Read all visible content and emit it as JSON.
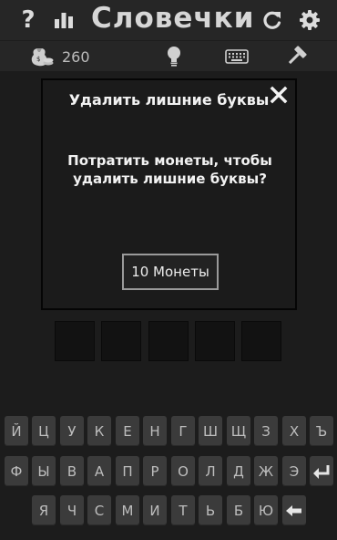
{
  "header": {
    "title": "Словечки",
    "help_label": "?"
  },
  "toolbar": {
    "coins": "260"
  },
  "dialog": {
    "title": "Удалить лишние буквы",
    "message": "Потратить монеты, чтобы удалить лишние буквы?",
    "button_label": "10 Монеты"
  },
  "keyboard": {
    "row1": [
      "Й",
      "Ц",
      "У",
      "К",
      "Е",
      "Н",
      "Г",
      "Ш",
      "Щ",
      "З",
      "Х",
      "Ъ"
    ],
    "row2": [
      "Ф",
      "Ы",
      "В",
      "А",
      "П",
      "Р",
      "О",
      "Л",
      "Д",
      "Ж",
      "Э"
    ],
    "row3": [
      "Я",
      "Ч",
      "С",
      "М",
      "И",
      "Т",
      "Ь",
      "Б",
      "Ю"
    ]
  },
  "icons": {
    "help": "help-icon",
    "stats": "stats-icon",
    "restart": "restart-icon",
    "settings": "gear-icon",
    "coins": "coin-bag-icon",
    "hint": "lightbulb-icon",
    "keyboard": "keyboard-icon",
    "hammer": "hammer-icon",
    "close": "close-icon",
    "enter": "enter-icon",
    "backspace": "backspace-icon"
  }
}
